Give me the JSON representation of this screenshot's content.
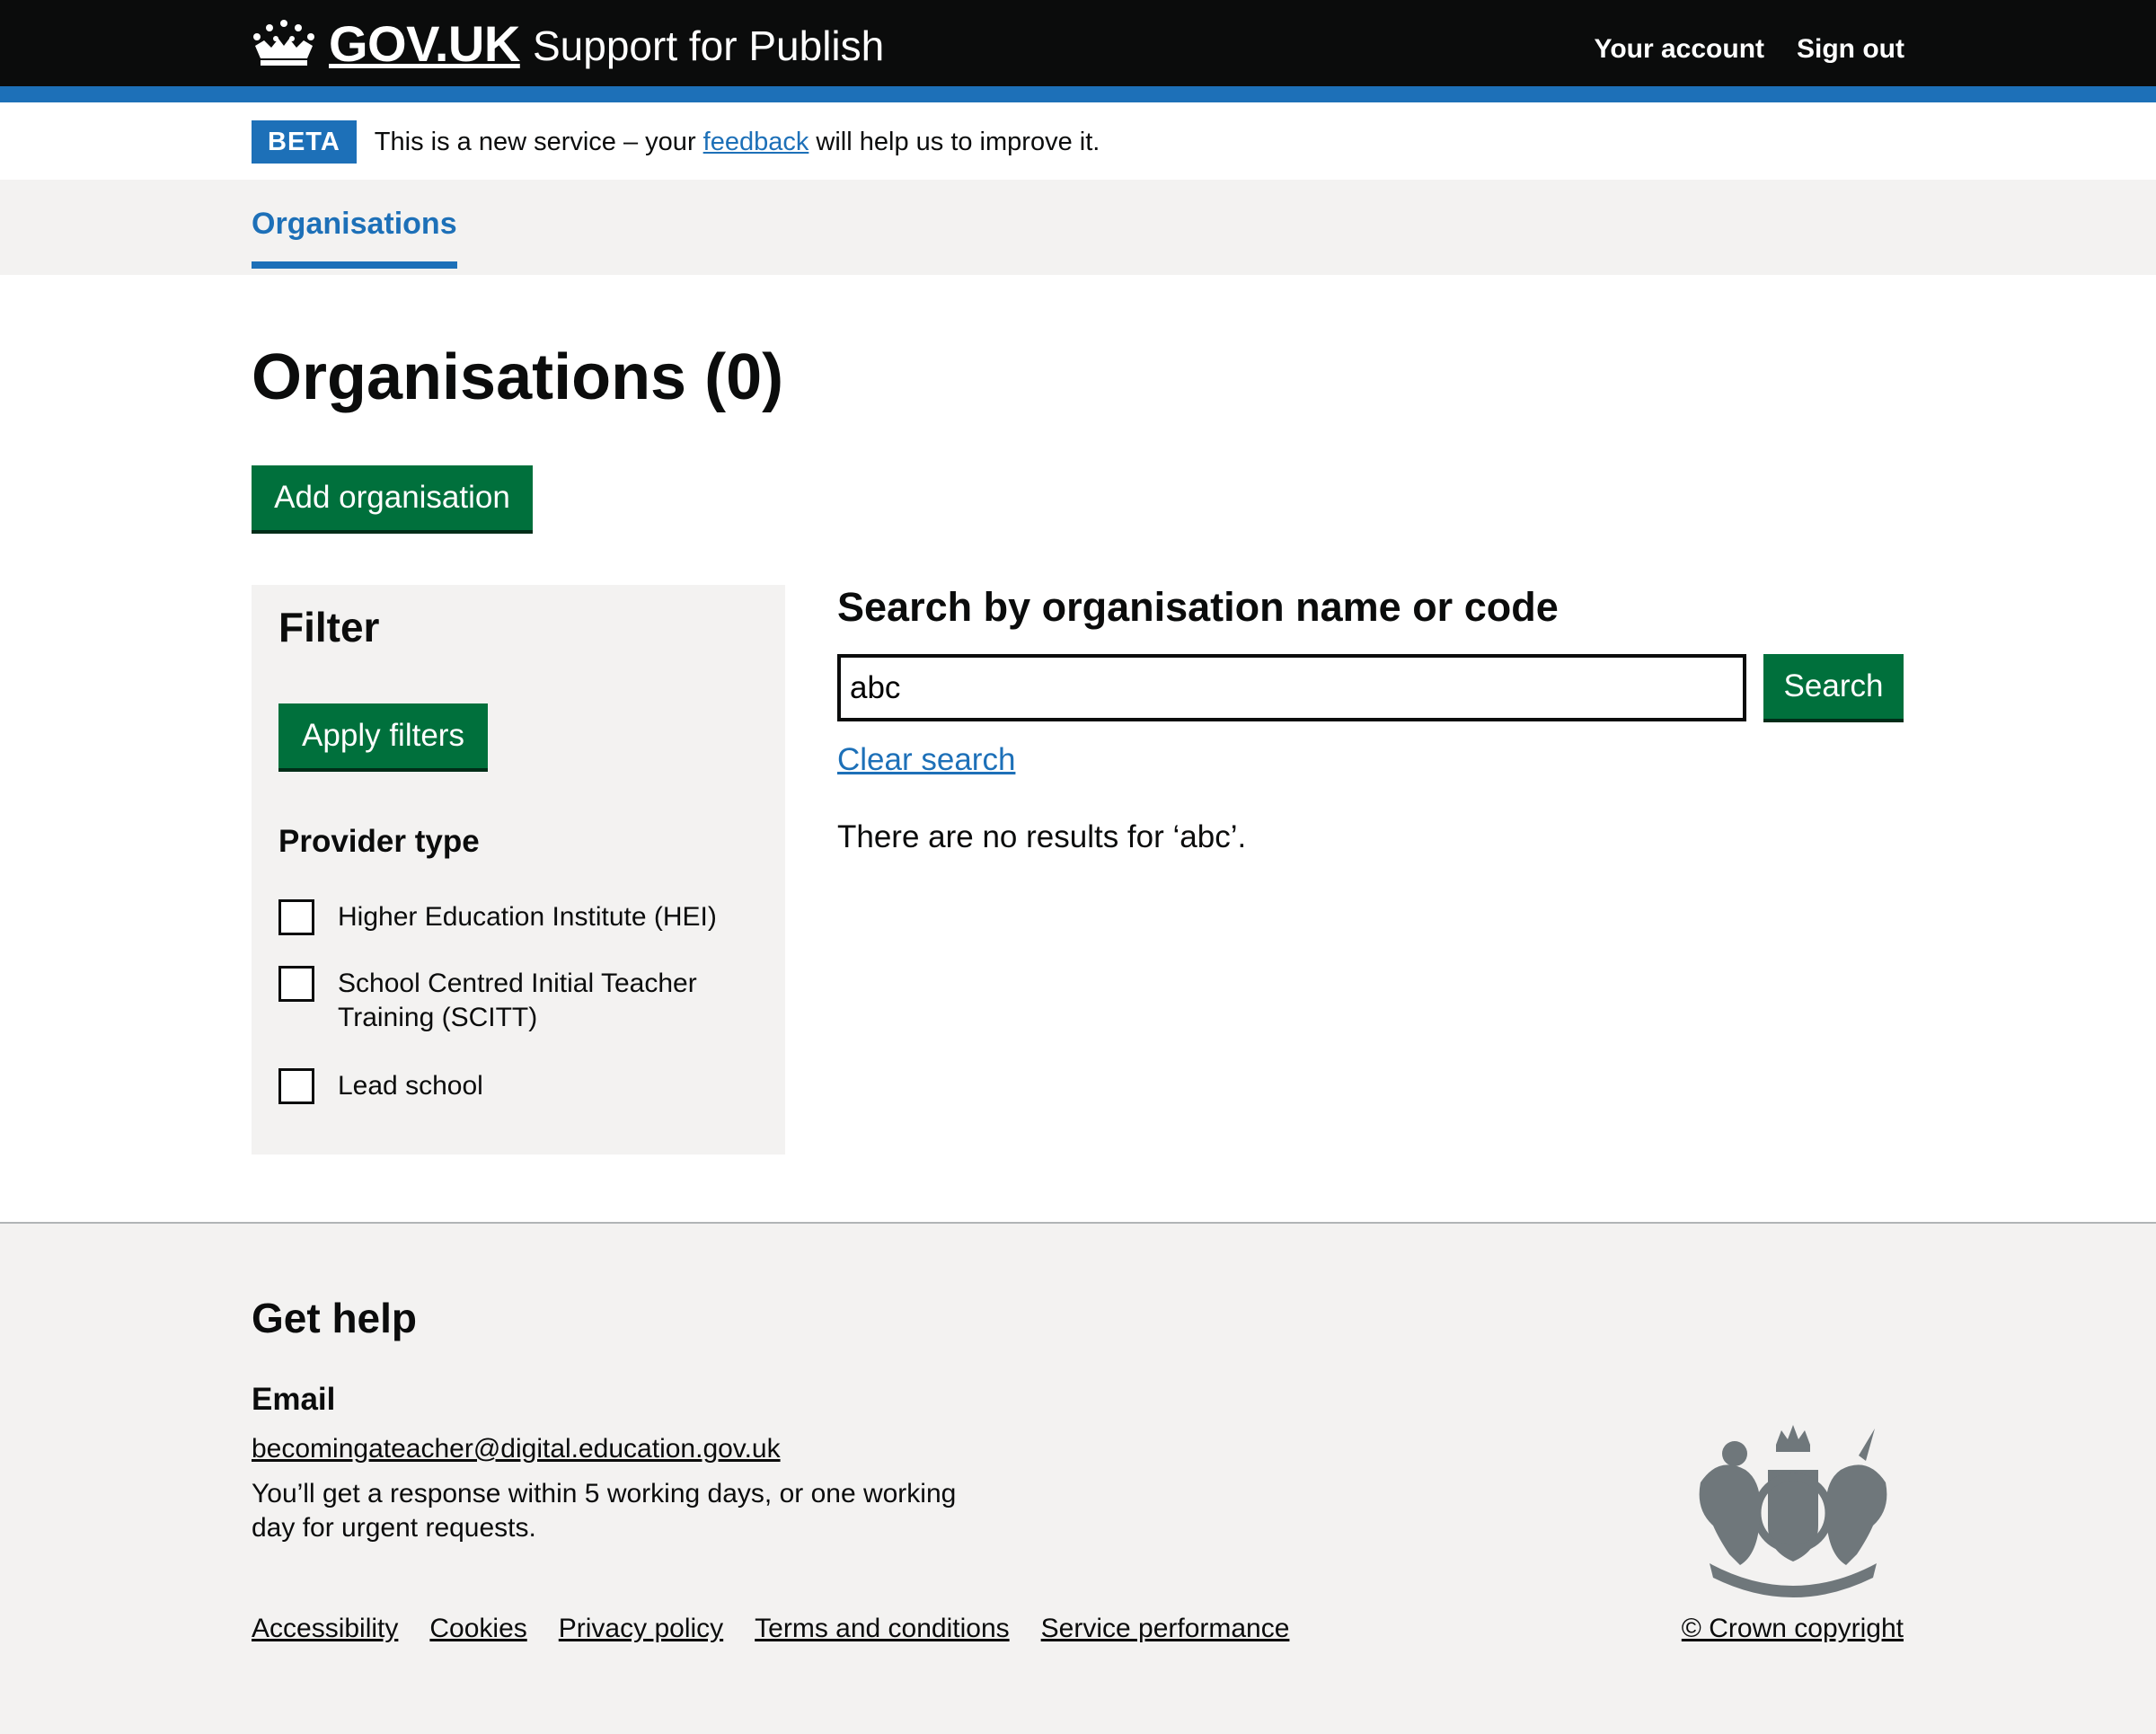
{
  "header": {
    "logo_text": "GOV.UK",
    "service_name": "Support for Publish",
    "nav": {
      "your_account": "Your account",
      "sign_out": "Sign out"
    }
  },
  "phase_banner": {
    "tag": "BETA",
    "text_before": "This is a new service – your ",
    "link": "feedback",
    "text_after": " will help us to improve it."
  },
  "primary_nav": {
    "organisations": "Organisations"
  },
  "main": {
    "title": "Organisations (0)",
    "add_button": "Add organisation",
    "filter": {
      "heading": "Filter",
      "apply_button": "Apply filters",
      "provider_type_legend": "Provider type",
      "options": [
        "Higher Education Institute (HEI)",
        "School Centred Initial Teacher Training (SCITT)",
        "Lead school"
      ]
    },
    "search": {
      "heading": "Search by organisation name or code",
      "value": "abc",
      "button": "Search",
      "clear_link": "Clear search",
      "no_results": "There are no results for ‘abc’."
    }
  },
  "footer": {
    "heading": "Get help",
    "email_heading": "Email",
    "email": "becomingateacher@digital.education.gov.uk",
    "response_text": "You’ll get a response within 5 working days, or one working day for urgent requests.",
    "links": [
      "Accessibility",
      "Cookies",
      "Privacy policy",
      "Terms and conditions",
      "Service performance"
    ],
    "copyright": "© Crown copyright"
  },
  "colors": {
    "header_bg": "#0b0c0c",
    "brand_blue": "#1d70b8",
    "button_green": "#00703c",
    "panel_grey": "#f3f2f1"
  }
}
